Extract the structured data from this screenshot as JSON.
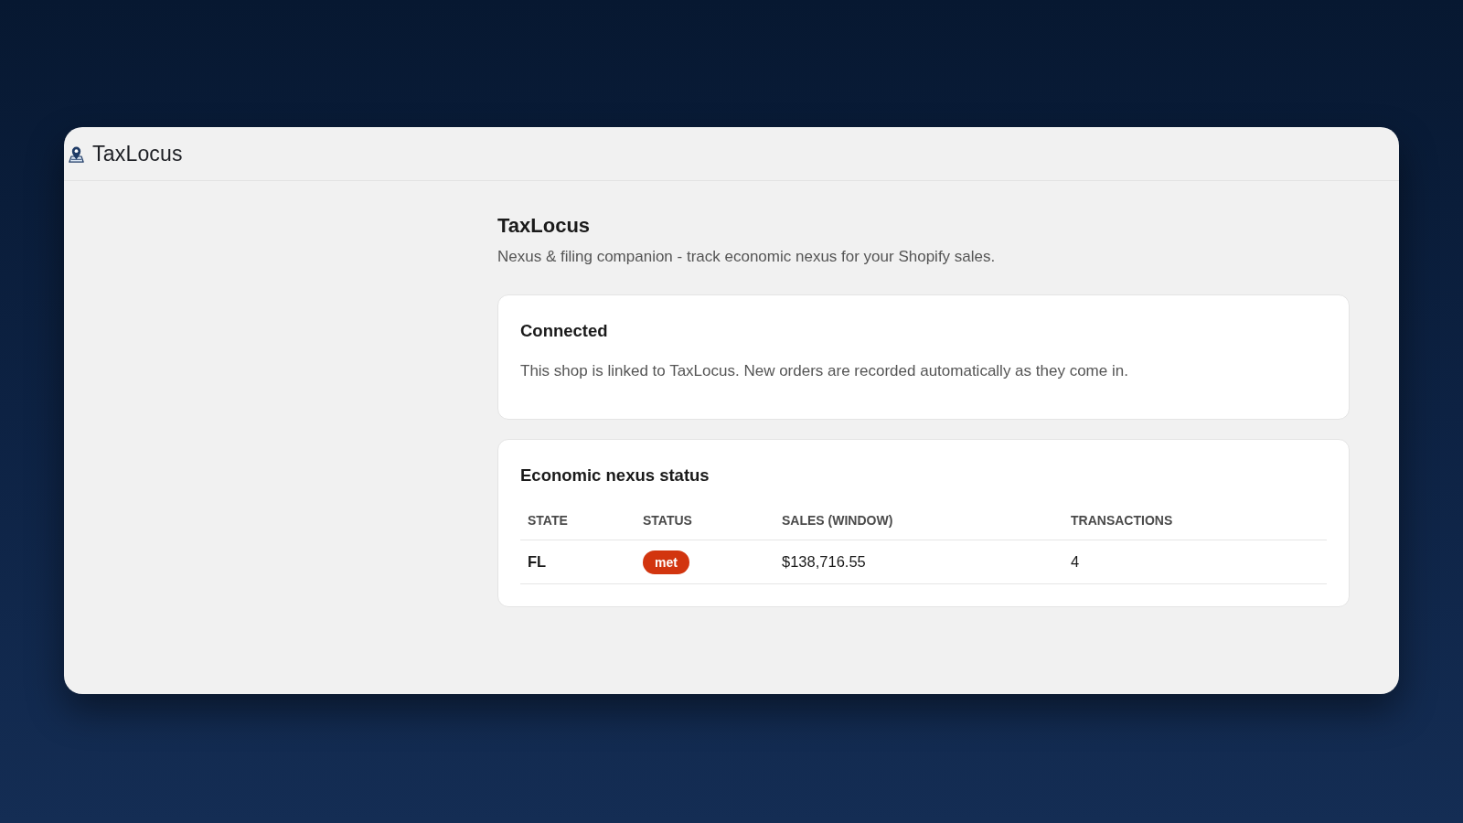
{
  "app_bar": {
    "title": "TaxLocus"
  },
  "page": {
    "title": "TaxLocus",
    "subtitle": "Nexus & filing companion - track economic nexus for your Shopify sales."
  },
  "connection_card": {
    "title": "Connected",
    "text": "This shop is linked to TaxLocus. New orders are recorded automatically as they come in."
  },
  "nexus_card": {
    "title": "Economic nexus status",
    "table": {
      "columns": [
        "STATE",
        "STATUS",
        "SALES (WINDOW)",
        "TRANSACTIONS"
      ],
      "rows": [
        {
          "state": "FL",
          "status": {
            "label": "met",
            "color": "#d2350f"
          },
          "sales": "$138,716.55",
          "transactions": "4"
        }
      ]
    }
  }
}
